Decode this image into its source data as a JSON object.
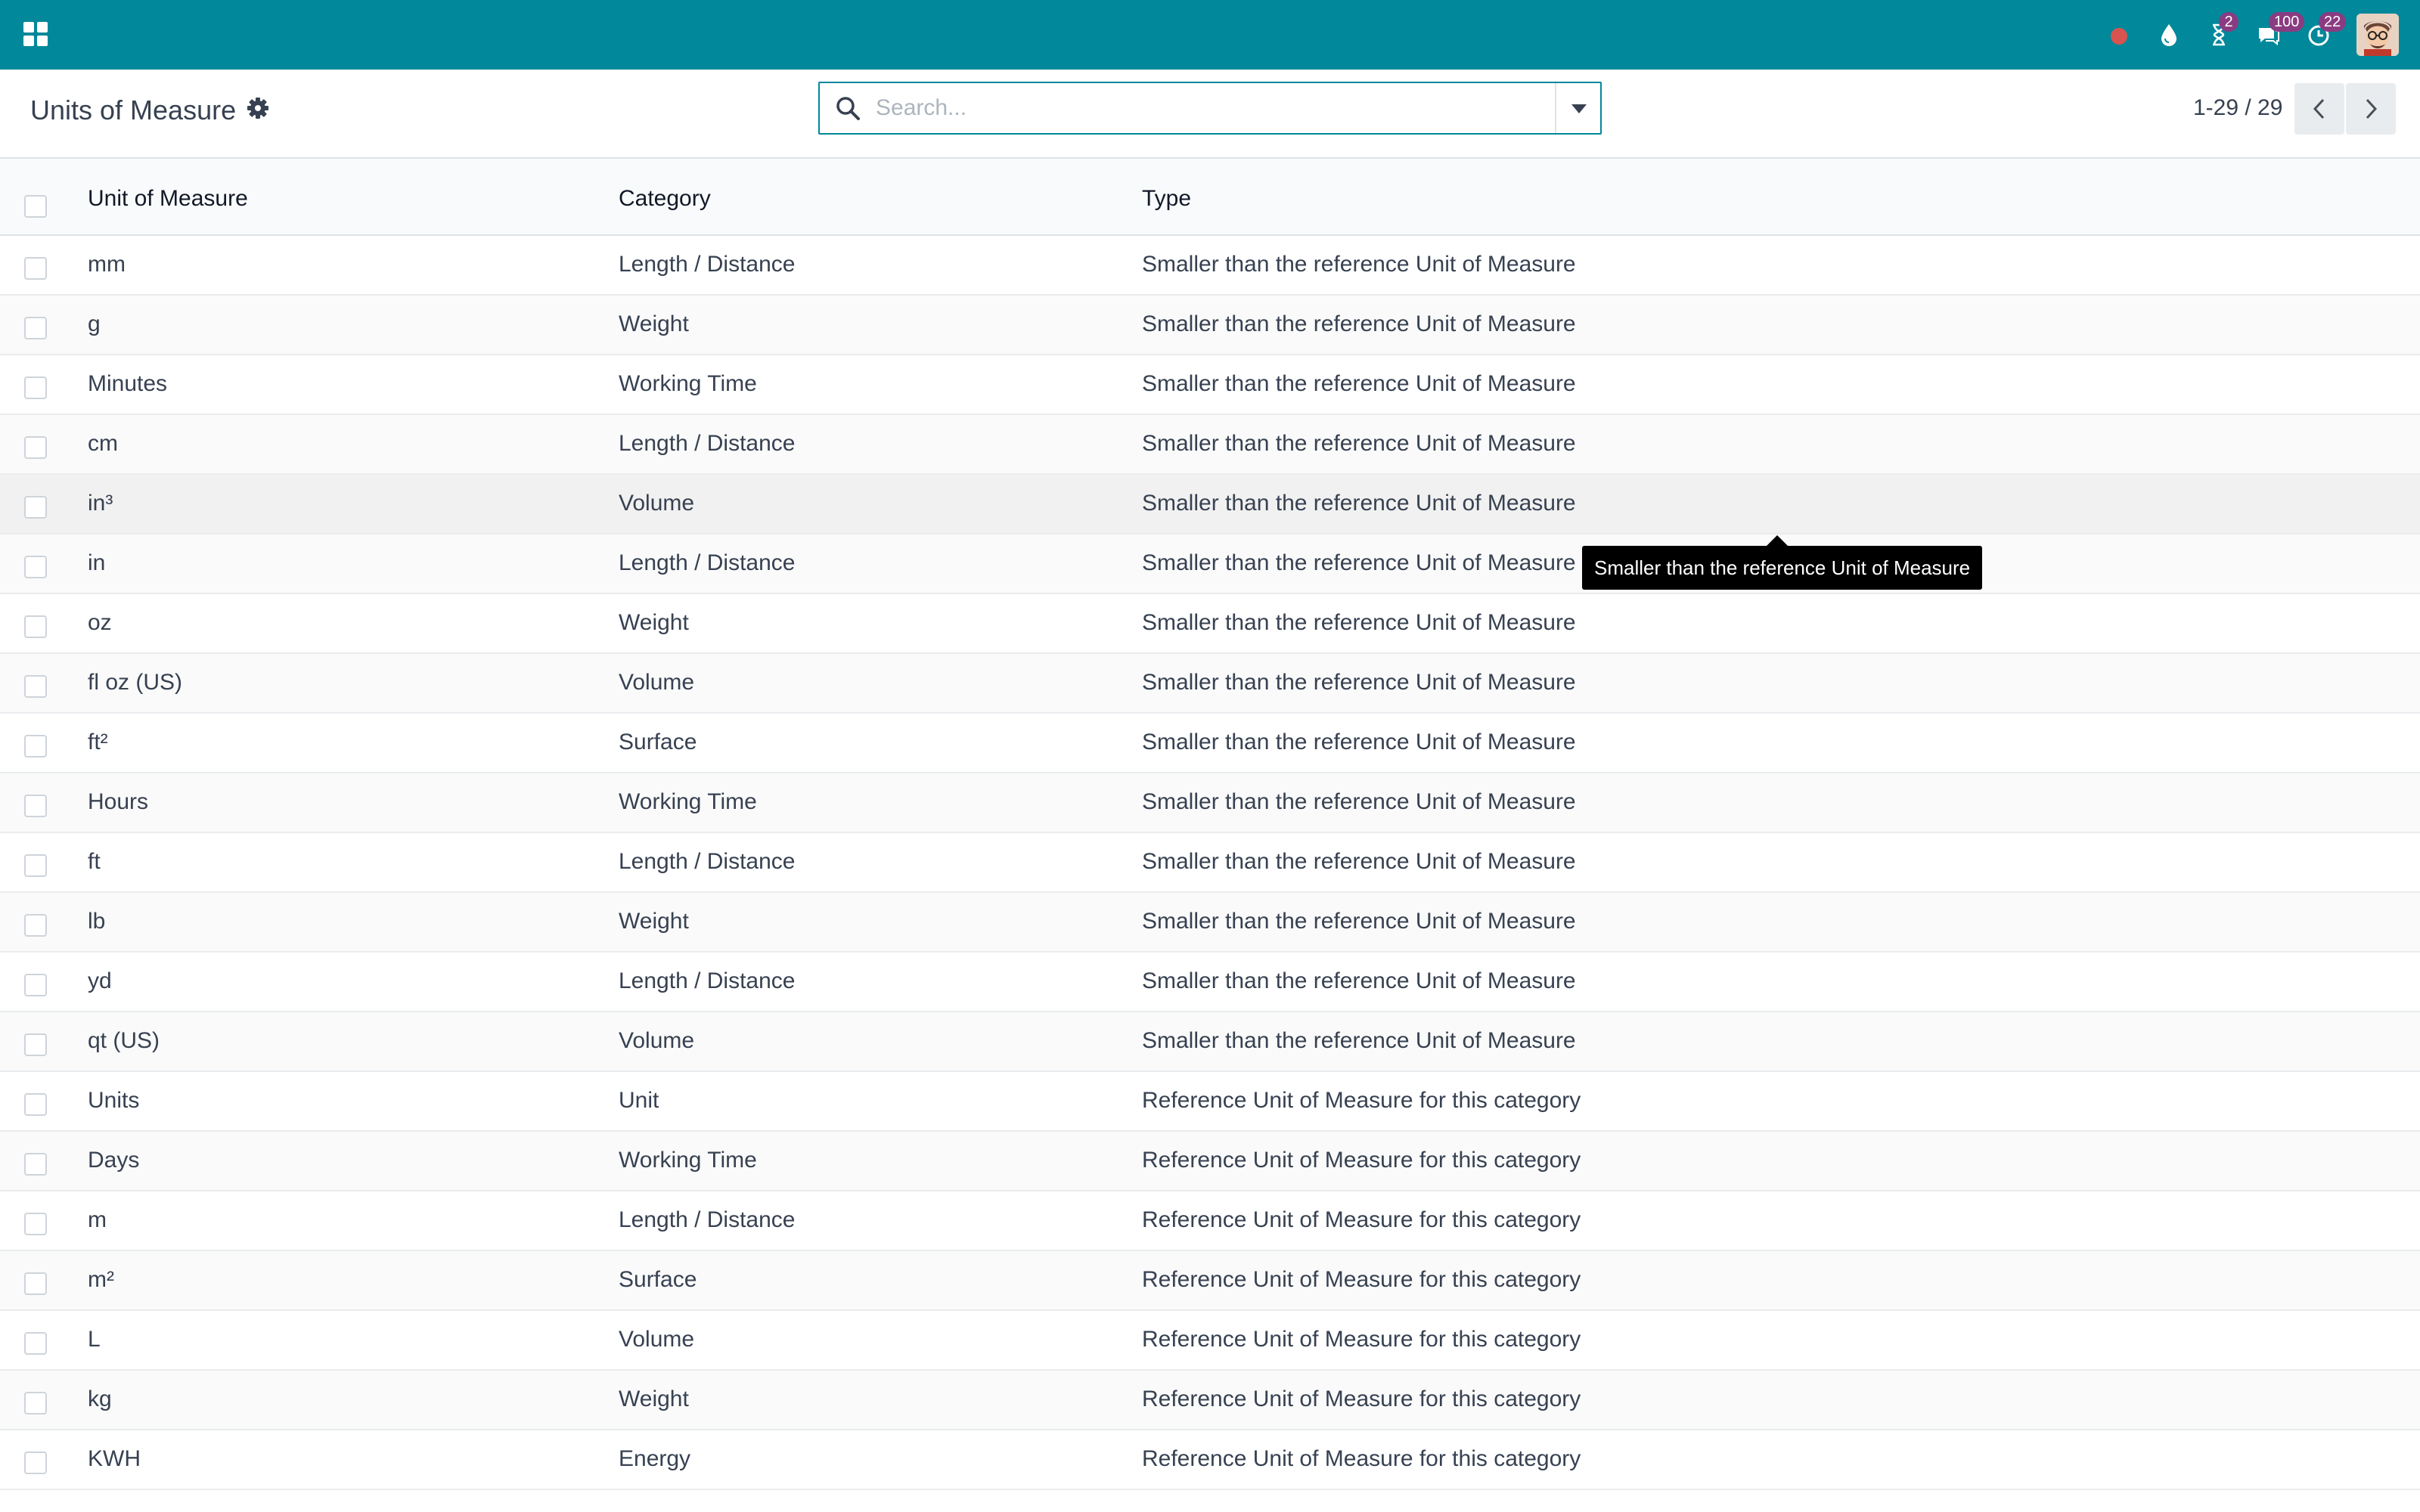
{
  "navbar": {
    "badges": {
      "activity": "2",
      "messages": "100",
      "clock": "22"
    }
  },
  "control_panel": {
    "title": "Units of Measure",
    "search_placeholder": "Search...",
    "pager": "1-29 / 29"
  },
  "table": {
    "headers": [
      "Unit of Measure",
      "Category",
      "Type"
    ],
    "rows": [
      [
        "mm",
        "Length / Distance",
        "Smaller than the reference Unit of Measure"
      ],
      [
        "g",
        "Weight",
        "Smaller than the reference Unit of Measure"
      ],
      [
        "Minutes",
        "Working Time",
        "Smaller than the reference Unit of Measure"
      ],
      [
        "cm",
        "Length / Distance",
        "Smaller than the reference Unit of Measure"
      ],
      [
        "in³",
        "Volume",
        "Smaller than the reference Unit of Measure"
      ],
      [
        "in",
        "Length / Distance",
        "Smaller than the reference Unit of Measure"
      ],
      [
        "oz",
        "Weight",
        "Smaller than the reference Unit of Measure"
      ],
      [
        "fl oz (US)",
        "Volume",
        "Smaller than the reference Unit of Measure"
      ],
      [
        "ft²",
        "Surface",
        "Smaller than the reference Unit of Measure"
      ],
      [
        "Hours",
        "Working Time",
        "Smaller than the reference Unit of Measure"
      ],
      [
        "ft",
        "Length / Distance",
        "Smaller than the reference Unit of Measure"
      ],
      [
        "lb",
        "Weight",
        "Smaller than the reference Unit of Measure"
      ],
      [
        "yd",
        "Length / Distance",
        "Smaller than the reference Unit of Measure"
      ],
      [
        "qt (US)",
        "Volume",
        "Smaller than the reference Unit of Measure"
      ],
      [
        "Units",
        "Unit",
        "Reference Unit of Measure for this category"
      ],
      [
        "Days",
        "Working Time",
        "Reference Unit of Measure for this category"
      ],
      [
        "m",
        "Length / Distance",
        "Reference Unit of Measure for this category"
      ],
      [
        "m²",
        "Surface",
        "Reference Unit of Measure for this category"
      ],
      [
        "L",
        "Volume",
        "Reference Unit of Measure for this category"
      ],
      [
        "kg",
        "Weight",
        "Reference Unit of Measure for this category"
      ],
      [
        "KWH",
        "Energy",
        "Reference Unit of Measure for this category"
      ]
    ]
  },
  "tooltip": "Smaller than the reference Unit of Measure",
  "colors": {
    "navbar": "#01889a",
    "badge": "#8a3c82",
    "recording_dot": "#d9534f"
  }
}
